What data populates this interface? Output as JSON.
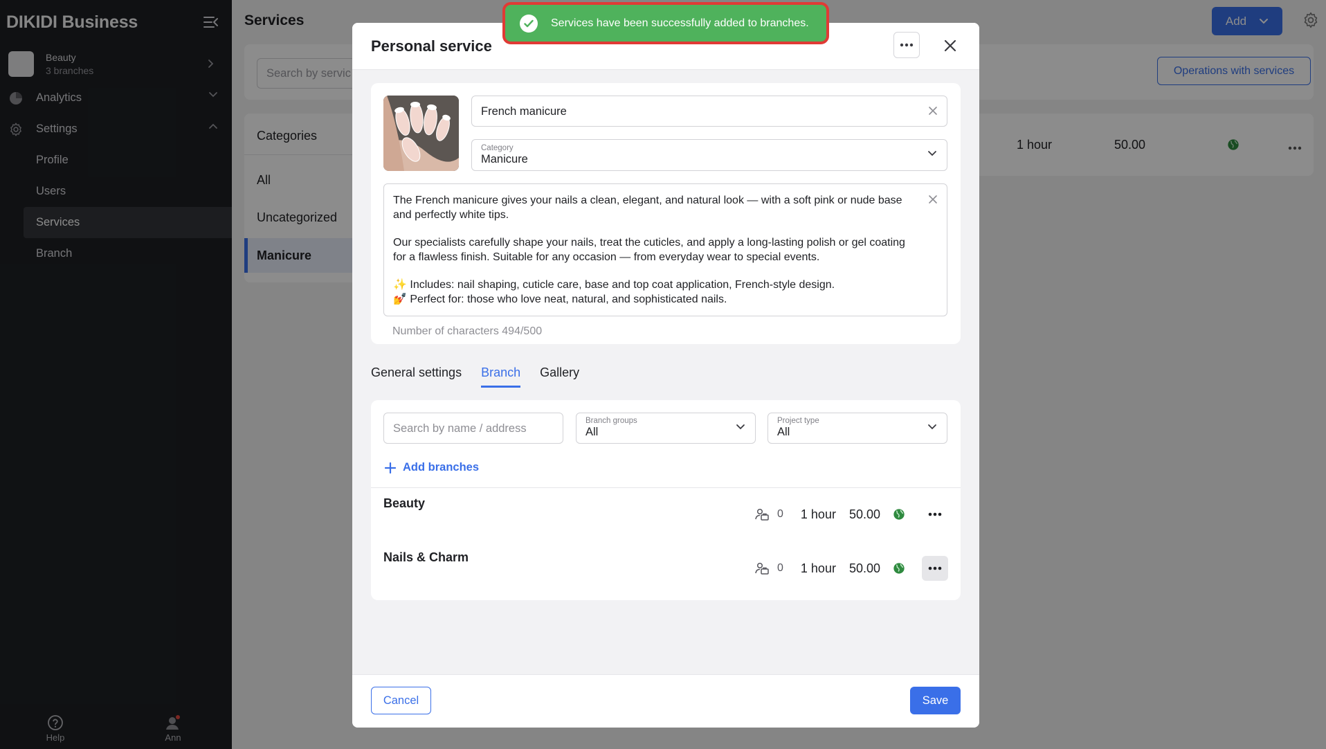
{
  "sidebar": {
    "brand": "DIKIDI Business",
    "account": {
      "name": "Beauty",
      "subtitle": "3 branches"
    },
    "nav": {
      "analytics": "Analytics",
      "settings": "Settings",
      "sub_items": [
        "Profile",
        "Users",
        "Services",
        "Branch"
      ],
      "active_sub_item": "Services"
    },
    "bottom": {
      "help": "Help",
      "user": "Ann"
    }
  },
  "background": {
    "page_title": "Services",
    "add_button": "Add",
    "search_placeholder": "Search by servic",
    "operations_button": "Operations with services",
    "categories_title": "Categories",
    "categories": [
      "All",
      "Uncategorized",
      "Manicure"
    ],
    "active_category": "Manicure",
    "service_row": {
      "duration": "1 hour",
      "price": "50.00"
    }
  },
  "toast": {
    "message": "Services have been successfully added to branches."
  },
  "modal": {
    "title": "Personal service",
    "service_name": "French manicure",
    "category_label": "Category",
    "category_value": "Manicure",
    "description": [
      "The French manicure gives your nails a clean, elegant, and natural look — with a soft pink or nude base and perfectly white tips.",
      "Our specialists carefully shape your nails, treat the cuticles, and apply a long-lasting polish or gel coating for a flawless finish. Suitable for any occasion — from everyday wear to special events.",
      "✨ Includes: nail shaping, cuticle care, base and top coat application, French-style design.",
      "💅 Perfect for: those who love neat, natural, and sophisticated nails."
    ],
    "char_count": "Number of characters 494/500",
    "tabs": [
      "General settings",
      "Branch",
      "Gallery"
    ],
    "active_tab": "Branch",
    "branch_search_placeholder": "Search by name / address",
    "branch_groups": {
      "label": "Branch groups",
      "value": "All"
    },
    "project_type": {
      "label": "Project type",
      "value": "All"
    },
    "add_branches": "Add branches",
    "branches": [
      {
        "name": "Beauty",
        "staff": "0",
        "duration": "1 hour",
        "price": "50.00"
      },
      {
        "name": "Nails & Charm",
        "staff": "0",
        "duration": "1 hour",
        "price": "50.00"
      }
    ],
    "cancel": "Cancel",
    "save": "Save"
  },
  "colors": {
    "accent": "#3a6fe8",
    "toast_bg": "#4fb25c",
    "toast_border": "#e03a35",
    "sidebar_bg": "#1e2024"
  }
}
